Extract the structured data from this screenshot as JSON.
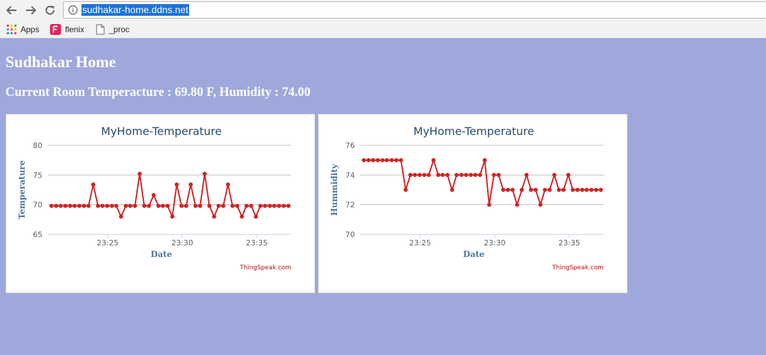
{
  "browser": {
    "url": "sudhakar-home.ddns.net",
    "bookmarks": [
      {
        "label": "Apps",
        "icon": "apps-grid-icon"
      },
      {
        "label": "flenix",
        "icon": "flenix-logo-icon"
      },
      {
        "label": "_proc",
        "icon": "page-icon"
      }
    ]
  },
  "page": {
    "title": "Sudhakar Home",
    "reading": "Current Room Temperacture : 69.80 F, Humidity : 74.00"
  },
  "chart_data": [
    {
      "type": "line",
      "title": "MyHome-Temperature",
      "xlabel": "Date",
      "ylabel": "Temperature",
      "credit": "ThingSpeak.com",
      "ylim": [
        65,
        80
      ],
      "yticks": [
        65,
        70,
        75,
        80
      ],
      "xlim": [
        "23:21:00",
        "23:37:18"
      ],
      "xticks": [
        "23:25",
        "23:30",
        "23:35"
      ],
      "grid": true,
      "color": "#cc2626",
      "x": [
        "23:21:14",
        "23:21:33",
        "23:21:51",
        "23:22:10",
        "23:22:29",
        "23:22:47",
        "23:23:06",
        "23:23:25",
        "23:23:43",
        "23:24:02",
        "23:24:21",
        "23:24:39",
        "23:24:58",
        "23:25:17",
        "23:25:35",
        "23:25:54",
        "23:26:13",
        "23:26:31",
        "23:26:50",
        "23:27:09",
        "23:27:27",
        "23:27:46",
        "23:28:05",
        "23:28:24",
        "23:28:42",
        "23:29:01",
        "23:29:20",
        "23:29:38",
        "23:29:57",
        "23:30:16",
        "23:30:34",
        "23:30:53",
        "23:31:12",
        "23:31:30",
        "23:31:49",
        "23:32:08",
        "23:32:26",
        "23:32:45",
        "23:33:04",
        "23:33:22",
        "23:33:41",
        "23:34:00",
        "23:34:18",
        "23:34:37",
        "23:34:56",
        "23:35:14",
        "23:35:33",
        "23:35:52",
        "23:36:10",
        "23:36:29",
        "23:36:48",
        "23:37:07"
      ],
      "y": [
        69.8,
        69.8,
        69.8,
        69.8,
        69.8,
        69.8,
        69.8,
        69.8,
        69.8,
        73.4,
        69.8,
        69.8,
        69.8,
        69.8,
        69.8,
        68.0,
        69.8,
        69.8,
        69.8,
        75.2,
        69.8,
        69.8,
        71.6,
        69.8,
        69.8,
        69.8,
        68.0,
        73.4,
        69.8,
        69.8,
        73.4,
        69.8,
        69.8,
        75.2,
        69.8,
        68.0,
        69.8,
        69.8,
        73.4,
        69.8,
        69.8,
        68.0,
        69.8,
        69.8,
        68.0,
        69.8,
        69.8,
        69.8,
        69.8,
        69.8,
        69.8,
        69.8,
        69.8,
        69.8,
        68.0,
        69.8,
        69.8,
        69.8,
        69.8,
        69.8,
        69.8,
        69.8
      ]
    },
    {
      "type": "line",
      "title": "MyHome-Temperature",
      "xlabel": "Date",
      "ylabel": "Hummidity",
      "credit": "ThingSpeak.com",
      "ylim": [
        70,
        76
      ],
      "yticks": [
        70,
        72,
        74,
        76
      ],
      "xlim": [
        "23:21:00",
        "23:37:18"
      ],
      "xticks": [
        "23:25",
        "23:30",
        "23:35"
      ],
      "grid": true,
      "color": "#cc2626",
      "x": [
        "23:21:14",
        "23:21:33",
        "23:21:51",
        "23:22:10",
        "23:22:29",
        "23:22:47",
        "23:23:06",
        "23:23:25",
        "23:23:43",
        "23:24:02",
        "23:24:21",
        "23:24:39",
        "23:24:58",
        "23:25:17",
        "23:25:35",
        "23:25:54",
        "23:26:13",
        "23:26:31",
        "23:26:50",
        "23:27:09",
        "23:27:27",
        "23:27:46",
        "23:28:05",
        "23:28:24",
        "23:28:42",
        "23:29:01",
        "23:29:20",
        "23:29:38",
        "23:29:57",
        "23:30:16",
        "23:30:34",
        "23:30:53",
        "23:31:12",
        "23:31:30",
        "23:31:49",
        "23:32:08",
        "23:32:26",
        "23:32:45",
        "23:33:04",
        "23:33:22",
        "23:33:41",
        "23:34:00",
        "23:34:18",
        "23:34:37",
        "23:34:56",
        "23:35:14",
        "23:35:33",
        "23:35:52",
        "23:36:10",
        "23:36:29",
        "23:36:48",
        "23:37:07"
      ],
      "y": [
        75,
        75,
        75,
        75,
        75,
        75,
        75,
        75,
        75,
        73,
        74,
        74,
        74,
        74,
        74,
        75,
        74,
        74,
        74,
        73,
        74,
        74,
        74,
        74,
        74,
        74,
        75,
        72,
        74,
        74,
        73,
        73,
        73,
        72,
        73,
        74,
        73,
        73,
        72,
        73,
        73,
        74,
        73,
        73,
        74,
        73,
        73,
        73,
        73,
        73,
        73,
        73,
        74,
        73,
        73,
        73,
        73,
        73,
        73,
        73
      ]
    }
  ]
}
